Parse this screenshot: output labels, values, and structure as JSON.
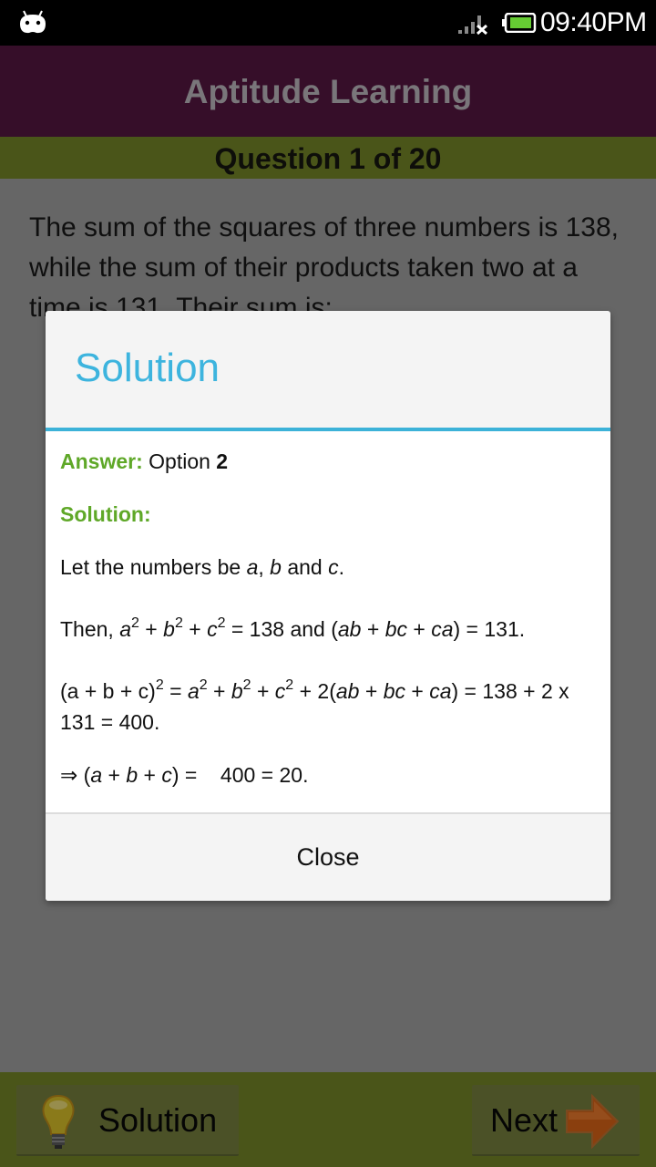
{
  "status_bar": {
    "time": "09:40PM",
    "icons": [
      "android-debug-icon",
      "signal-no-data-icon",
      "battery-icon"
    ],
    "battery_color": "#66cc33"
  },
  "app": {
    "title": "Aptitude Learning",
    "question_counter": "Question 1 of 20",
    "question_text": "The sum of the squares of three numbers is 138, while the sum of their products taken two at a time is 131. Their sum is:"
  },
  "dialog": {
    "title": "Solution",
    "accent_color": "#3db4de",
    "answer_label": "Answer:",
    "answer_prefix": "Option",
    "answer_value": "2",
    "solution_label": "Solution:",
    "lines": {
      "l1_pre": "Let the numbers be ",
      "l1_a": "a",
      "l1_sep1": ", ",
      "l1_b": "b",
      "l1_and": " and ",
      "l1_c": "c",
      "l1_end": ".",
      "l2_pre": "Then, ",
      "l2_a": "a",
      "l2_b": "b",
      "l2_c": "c",
      "sq": "2",
      "plus": " + ",
      "l2_mid": " = 138 and (",
      "l2_ab": "ab",
      "l2_bc": "bc",
      "l2_ca": "ca",
      "l2_end": ") = 131.",
      "l3_pre": "(a + b + c)",
      "l3_eq": " = ",
      "l3_2": " + 2(",
      "l3_end": ") = 138 + 2 x 131 = 400.",
      "l4_arrow": "⇒",
      "l4_open": " (",
      "l4_end": ") =    400 = 20."
    },
    "close_label": "Close"
  },
  "bottom_bar": {
    "solution_button": "Solution",
    "next_button": "Next"
  }
}
